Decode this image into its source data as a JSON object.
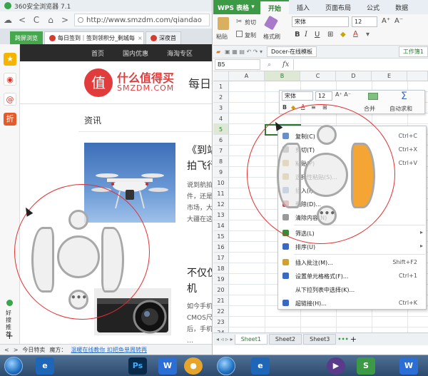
{
  "browser": {
    "app_title": "360安全浏览器 7.1",
    "url": "http://www.smzdm.com/qiandao",
    "tabs": [
      {
        "label": "跨屏浏览"
      },
      {
        "label": "每日签到｜签到领积分_剩城每"
      },
      {
        "label": "深夜首"
      }
    ],
    "site_nav": [
      "首页",
      "国内优惠",
      "海淘专区"
    ],
    "logo_char": "值",
    "site_name": "什么值得买",
    "site_domain": "SMZDM.COM",
    "page_heading": "每日签",
    "section": "资讯",
    "articles": [
      {
        "title_lines": [
          "《到站",
          "拍飞行"
        ],
        "body_lines": [
          "说到航拍",
          "件，还是",
          "市场，大",
          "大疆在这"
        ]
      },
      {
        "title_lines": [
          "不仅仅",
          "机"
        ],
        "body_lines": [
          "如今手机",
          "CMOS尺",
          "后，手机",
          "…"
        ]
      }
    ],
    "side_labels": [
      "好",
      "搜",
      "推",
      "荐"
    ],
    "status": {
      "weather": "今日特卖",
      "shop": "魔方：",
      "news": "温暖在线教你 扣把鱼单周转再"
    }
  },
  "wps": {
    "app_name": "WPS 表格",
    "menu_tabs": [
      "开始",
      "插入",
      "页面布局",
      "公式",
      "数据"
    ],
    "ribbon": {
      "paste": "粘贴",
      "cut": "剪切",
      "copy": "复制",
      "format_brush": "格式刷",
      "font_name": "宋体",
      "font_size": "12"
    },
    "doc_tab": "Docer-在线模板",
    "workbook_tab": "工作簿1",
    "name_box": "B5",
    "fx": "fx",
    "columns": [
      "A",
      "B",
      "C",
      "D",
      "E"
    ],
    "rows": [
      "1",
      "2",
      "3",
      "4",
      "5",
      "6",
      "7",
      "8",
      "9",
      "10",
      "11",
      "12",
      "13",
      "14",
      "15",
      "16",
      "17",
      "18",
      "19",
      "20",
      "21",
      "22",
      "23",
      "24"
    ],
    "floating_toolbar": {
      "font": "宋体",
      "size": "12",
      "merge": "合并",
      "autosum": "自动求和"
    },
    "context_menu": [
      {
        "label": "复制(C)",
        "shortcut": "Ctrl+C",
        "color": "#6a8fc4"
      },
      {
        "label": "剪切(T)",
        "shortcut": "Ctrl+X",
        "color": "#7a7a7a"
      },
      {
        "label": "粘贴(P)",
        "shortcut": "Ctrl+V",
        "color": "#c0a040"
      },
      {
        "label": "选择性粘贴(S)...",
        "shortcut": "",
        "color": "#c0a040"
      },
      {
        "label": "插入(I)",
        "shortcut": "",
        "color": "#6a8fc4"
      },
      {
        "label": "删除(D)...",
        "shortcut": "",
        "color": "#d04040"
      },
      {
        "label": "清除内容(N)",
        "shortcut": "",
        "color": "#999999"
      },
      {
        "label": "筛选(L)",
        "shortcut": "",
        "color": "#3a8a3a",
        "submenu": true
      },
      {
        "label": "排序(U)",
        "shortcut": "",
        "color": "#3a6ac0",
        "submenu": true
      },
      {
        "label": "插入批注(M)...",
        "shortcut": "Shift+F2",
        "color": "#d0a030"
      },
      {
        "label": "设置单元格格式(F)...",
        "shortcut": "Ctrl+1",
        "color": "#3a6ac0"
      },
      {
        "label": "从下拉列表中选择(K)...",
        "shortcut": "",
        "color": "#ffffff"
      },
      {
        "label": "超链接(H)...",
        "shortcut": "Ctrl+K",
        "color": "#3a6ac0"
      }
    ],
    "sheets": [
      "Sheet1",
      "Sheet2",
      "Sheet3"
    ]
  },
  "taskbar": {
    "apps": [
      "e",
      "Ps",
      "W",
      "e"
    ]
  },
  "colors": {
    "accent_red": "#e23b3b",
    "wps_green": "#3c9a46",
    "gesture_orange": "#f4a533",
    "ring_red": "#e23030"
  }
}
